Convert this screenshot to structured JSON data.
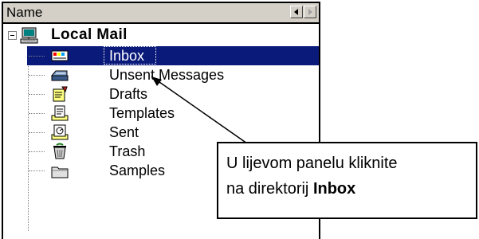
{
  "header": {
    "column_label": "Name",
    "scroll_left_icon": "arrow-left-icon",
    "scroll_right_icon": "arrow-right-icon"
  },
  "tree": {
    "root": {
      "label": "Local Mail",
      "icon": "computer-icon",
      "expanded": true
    },
    "items": [
      {
        "label": "Inbox",
        "icon": "inbox-icon",
        "selected": true
      },
      {
        "label": "Unsent Messages",
        "icon": "outbox-icon",
        "selected": false
      },
      {
        "label": "Drafts",
        "icon": "drafts-icon",
        "selected": false
      },
      {
        "label": "Templates",
        "icon": "templates-icon",
        "selected": false
      },
      {
        "label": "Sent",
        "icon": "sent-icon",
        "selected": false
      },
      {
        "label": "Trash",
        "icon": "trash-icon",
        "selected": false
      },
      {
        "label": "Samples",
        "icon": "folder-icon",
        "selected": false
      }
    ]
  },
  "callout": {
    "line1": "U lijevom panelu kliknite",
    "line2_prefix": "na direktorij ",
    "line2_bold": "Inbox"
  },
  "colors": {
    "selection": "#0a1a7a",
    "header_bg": "#d4d0c8"
  }
}
